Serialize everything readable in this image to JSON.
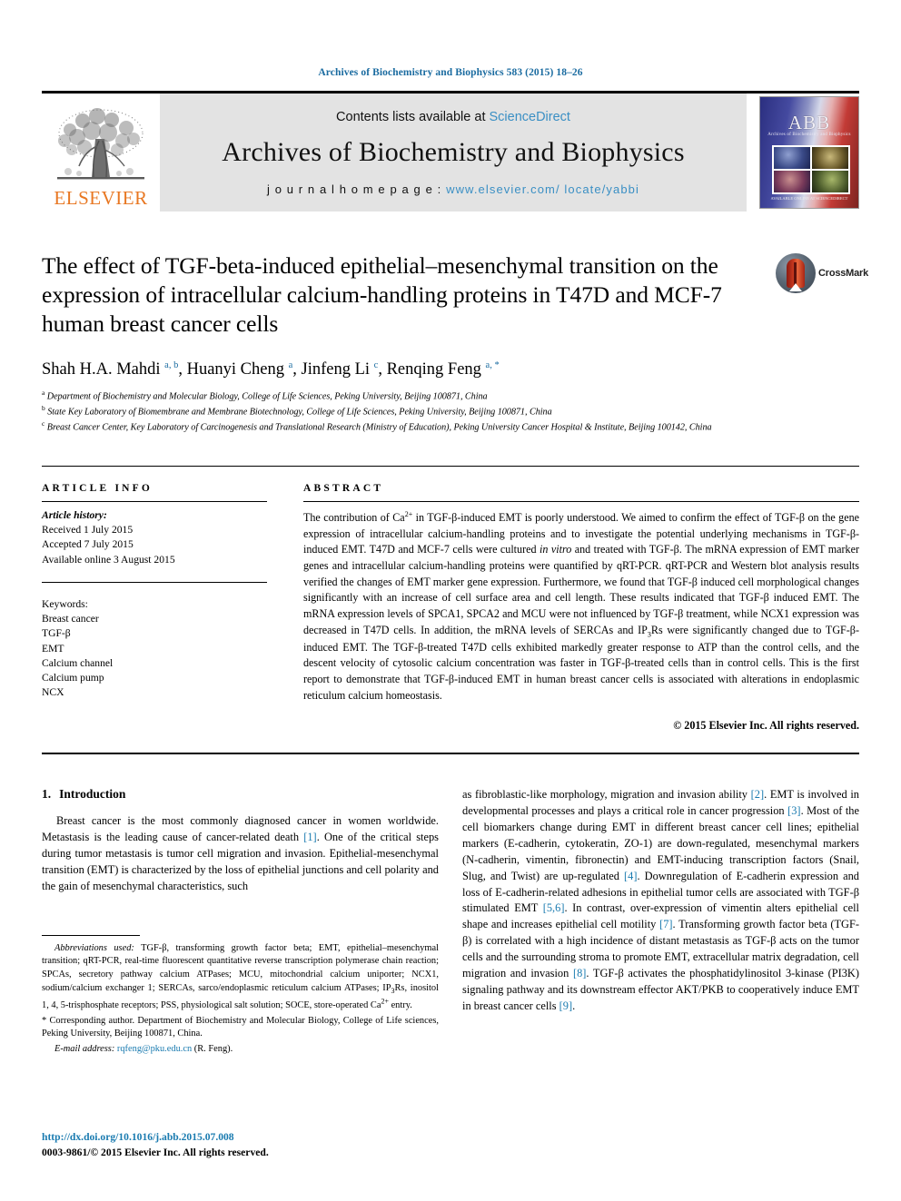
{
  "running_head": "Archives of Biochemistry and Biophysics 583 (2015) 18–26",
  "masthead": {
    "publisher_name": "ELSEVIER",
    "contents_prefix": "Contents lists available at ",
    "contents_link": "ScienceDirect",
    "journal_name": "Archives of Biochemistry and Biophysics",
    "homepage_label": "j o u r n a l   h o m e p a g e :   ",
    "homepage_url": "www.elsevier.com/ locate/yabbi",
    "cover_title": "ABB",
    "cover_subtitle": "Archives of Biochemistry and Biophysics",
    "cover_footer": "AVAILABLE ONLINE AT SCIENCEDIRECT"
  },
  "article": {
    "title": "The effect of TGF-beta-induced epithelial–mesenchymal transition on the expression of intracellular calcium-handling proteins in T47D and MCF-7 human breast cancer cells",
    "crossmark_label": "CrossMark",
    "authors_html": "Shah H.A. Mahdi <sup>a, b</sup>, Huanyi Cheng <sup>a</sup>, Jinfeng Li <sup>c</sup>, Renqing Feng <sup>a, *</sup>",
    "affiliations": [
      "Department of Biochemistry and Molecular Biology, College of Life Sciences, Peking University, Beijing 100871, China",
      "State Key Laboratory of Biomembrane and Membrane Biotechnology, College of Life Sciences, Peking University, Beijing 100871, China",
      "Breast Cancer Center, Key Laboratory of Carcinogenesis and Translational Research (Ministry of Education), Peking University Cancer Hospital & Institute, Beijing 100142, China"
    ],
    "affiliation_markers": [
      "a",
      "b",
      "c"
    ]
  },
  "article_info": {
    "heading": "ARTICLE INFO",
    "history_label": "Article history:",
    "history": [
      "Received 1 July 2015",
      "Accepted 7 July 2015",
      "Available online 3 August 2015"
    ],
    "keywords_label": "Keywords:",
    "keywords": [
      "Breast cancer",
      "TGF-β",
      "EMT",
      "Calcium channel",
      "Calcium pump",
      "NCX"
    ]
  },
  "abstract": {
    "heading": "ABSTRACT",
    "text": "The contribution of Ca2+ in TGF-β-induced EMT is poorly understood. We aimed to confirm the effect of TGF-β on the gene expression of intracellular calcium-handling proteins and to investigate the potential underlying mechanisms in TGF-β-induced EMT. T47D and MCF-7 cells were cultured in vitro and treated with TGF-β. The mRNA expression of EMT marker genes and intracellular calcium-handling proteins were quantified by qRT-PCR. qRT-PCR and Western blot analysis results verified the changes of EMT marker gene expression. Furthermore, we found that TGF-β induced cell morphological changes significantly with an increase of cell surface area and cell length. These results indicated that TGF-β induced EMT. The mRNA expression levels of SPCA1, SPCA2 and MCU were not influenced by TGF-β treatment, while NCX1 expression was decreased in T47D cells. In addition, the mRNA levels of SERCAs and IP3Rs were significantly changed due to TGF-β-induced EMT. The TGF-β-treated T47D cells exhibited markedly greater response to ATP than the control cells, and the descent velocity of cytosolic calcium concentration was faster in TGF-β-treated cells than in control cells. This is the first report to demonstrate that TGF-β-induced EMT in human breast cancer cells is associated with alterations in endoplasmic reticulum calcium homeostasis.",
    "copyright": "© 2015 Elsevier Inc. All rights reserved."
  },
  "introduction": {
    "number": "1.",
    "heading": "Introduction",
    "left_paragraph": "Breast cancer is the most commonly diagnosed cancer in women worldwide. Metastasis is the leading cause of cancer-related death [1]. One of the critical steps during tumor metastasis is tumor cell migration and invasion. Epithelial-mesenchymal transition (EMT) is characterized by the loss of epithelial junctions and cell polarity and the gain of mesenchymal characteristics, such",
    "right_paragraph": "as fibroblastic-like morphology, migration and invasion ability [2]. EMT is involved in developmental processes and plays a critical role in cancer progression [3]. Most of the cell biomarkers change during EMT in different breast cancer cell lines; epithelial markers (E-cadherin, cytokeratin, ZO-1) are down-regulated, mesenchymal markers (N-cadherin, vimentin, fibronectin) and EMT-inducing transcription factors (Snail, Slug, and Twist) are up-regulated [4]. Downregulation of E-cadherin expression and loss of E-cadherin-related adhesions in epithelial tumor cells are associated with TGF-β stimulated EMT [5,6]. In contrast, over-expression of vimentin alters epithelial cell shape and increases epithelial cell motility [7]. Transforming growth factor beta (TGF-β) is correlated with a high incidence of distant metastasis as TGF-β acts on the tumor cells and the surrounding stroma to promote EMT, extracellular matrix degradation, cell migration and invasion [8]. TGF-β activates the phosphatidylinositol 3-kinase (PI3K) signaling pathway and its downstream effector AKT/PKB to cooperatively induce EMT in breast cancer cells [9]."
  },
  "footnotes": {
    "abbreviations_label": "Abbreviations used:",
    "abbreviations_text": " TGF-β, transforming growth factor beta; EMT, epithelial–mesenchymal transition; qRT-PCR, real-time fluorescent quantitative reverse transcription polymerase chain reaction; SPCAs, secretory pathway calcium ATPases; MCU, mitochondrial calcium uniporter; NCX1, sodium/calcium exchanger 1; SERCAs, sarco/endoplasmic reticulum calcium ATPases; IP3Rs, inositol 1, 4, 5-trisphosphate receptors; PSS, physiological salt solution; SOCE, store-operated Ca2+ entry.",
    "corresponding_marker": "*",
    "corresponding_text": " Corresponding author. Department of Biochemistry and Molecular Biology, College of Life sciences, Peking University, Beijing 100871, China.",
    "email_label": "E-mail address:",
    "email": "rqfeng@pku.edu.cn",
    "email_suffix": " (R. Feng)."
  },
  "page_footer": {
    "doi": "http://dx.doi.org/10.1016/j.abb.2015.07.008",
    "issn_line": "0003-9861/© 2015 Elsevier Inc. All rights reserved."
  },
  "colors": {
    "link_blue": "#1a7bb0",
    "header_blue": "#1a6ba0",
    "elsevier_orange": "#E87722",
    "band_gray": "#e3e3e3"
  }
}
